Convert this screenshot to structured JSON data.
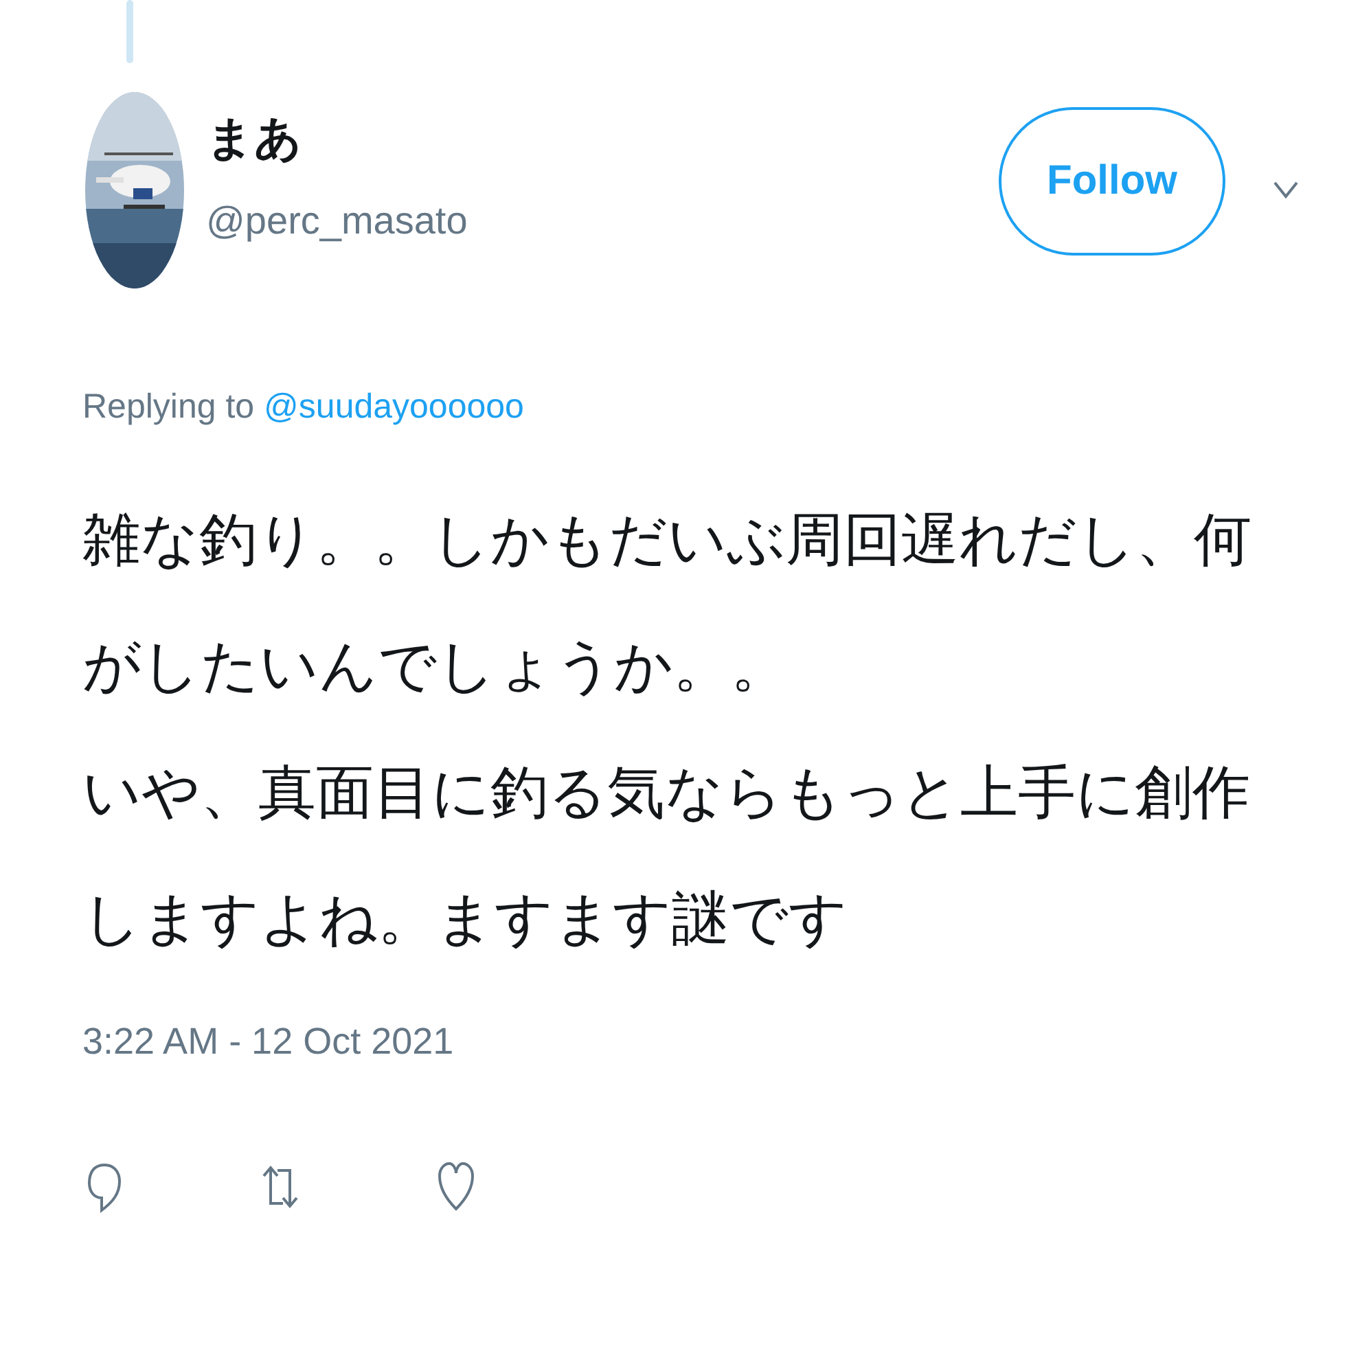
{
  "author": {
    "name": "まあ",
    "handle": "@perc_masato"
  },
  "follow_button": {
    "label": "Follow"
  },
  "reply_to": {
    "prefix": "Replying to",
    "handle": "@suudayoooooo"
  },
  "tweet_lines": [
    "雑な釣り。。しかもだいぶ周回遅れだし、何",
    "がしたいんでしょうか。。",
    "いや、真面目に釣る気ならもっと上手に創作",
    "しますよね。ますます謎です"
  ],
  "timestamp": "3:22 AM - 12 Oct 2021"
}
